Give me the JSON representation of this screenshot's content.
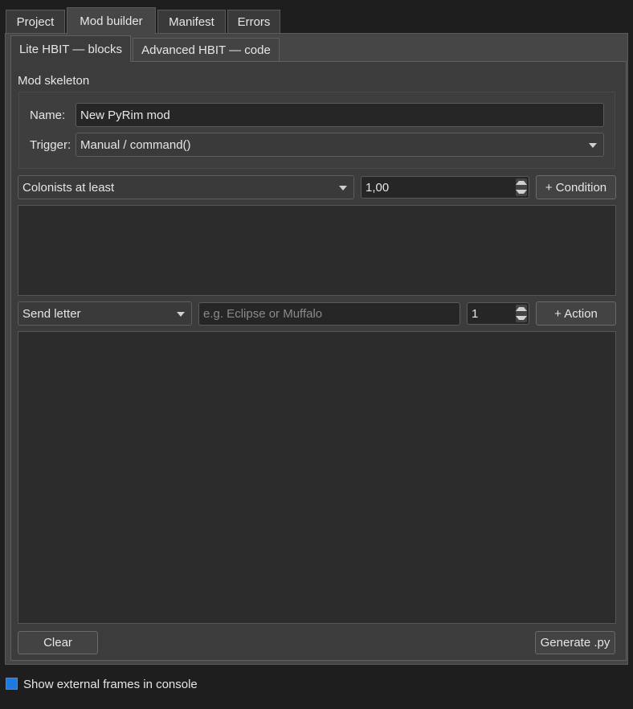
{
  "tabs": [
    {
      "label": "Project"
    },
    {
      "label": "Mod builder"
    },
    {
      "label": "Manifest"
    },
    {
      "label": "Errors"
    }
  ],
  "subtabs": [
    {
      "label": "Lite HBIT — blocks"
    },
    {
      "label": "Advanced HBIT — code"
    }
  ],
  "skeleton": {
    "title": "Mod skeleton",
    "name_label": "Name:",
    "name_value": "New PyRim mod",
    "trigger_label": "Trigger:",
    "trigger_value": "Manual / command()"
  },
  "condition": {
    "type_value": "Colonists at least",
    "number_value": "1,00",
    "add_label": "+ Condition"
  },
  "action": {
    "type_value": "Send letter",
    "target_placeholder": "e.g. Eclipse or Muffalo",
    "count_value": "1",
    "add_label": "+ Action"
  },
  "footer": {
    "clear_label": "Clear",
    "generate_label": "Generate .py"
  },
  "console_option": {
    "label": "Show external frames in console",
    "checked": true
  },
  "colors": {
    "background": "#1e1e1e",
    "panel": "#3c3c3c",
    "checkbox_accent": "#1e7ae0"
  }
}
